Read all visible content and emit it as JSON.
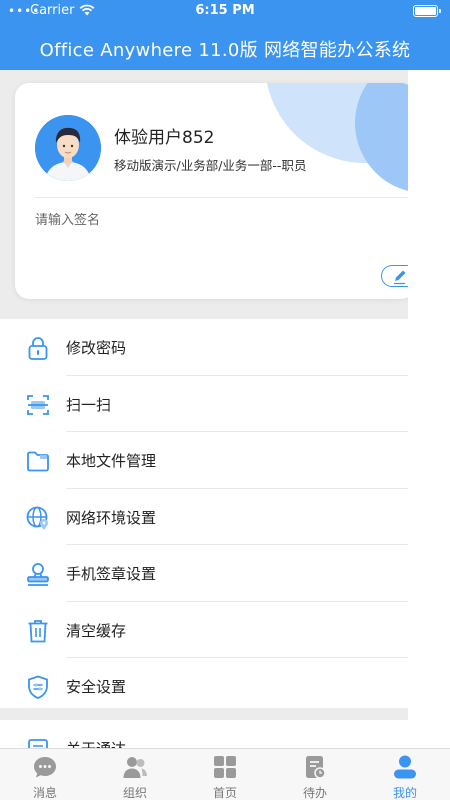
{
  "status_bar": {
    "carrier": "Carrier",
    "time": "6:15 PM"
  },
  "header": {
    "title": "Office Anywhere 11.0版 网络智能办公系统"
  },
  "profile": {
    "name": "体验用户852",
    "department": "移动版演示/业务部/业务一部--职员",
    "signature_placeholder": "请输入签名"
  },
  "menu": [
    {
      "label": "修改密码",
      "icon": "lock-icon"
    },
    {
      "label": "扫一扫",
      "icon": "scan-icon"
    },
    {
      "label": "本地文件管理",
      "icon": "folder-icon"
    },
    {
      "label": "网络环境设置",
      "icon": "globe-icon"
    },
    {
      "label": "手机签章设置",
      "icon": "stamp-icon"
    },
    {
      "label": "清空缓存",
      "icon": "trash-icon"
    },
    {
      "label": "安全设置",
      "icon": "shield-icon"
    }
  ],
  "menu2": [
    {
      "label": "关于通达",
      "icon": "info-icon"
    }
  ],
  "tabs": [
    {
      "label": "消息",
      "icon": "message-icon",
      "active": false
    },
    {
      "label": "组织",
      "icon": "contacts-icon",
      "active": false
    },
    {
      "label": "首页",
      "icon": "home-grid-icon",
      "active": false
    },
    {
      "label": "待办",
      "icon": "todo-icon",
      "active": false
    },
    {
      "label": "我的",
      "icon": "profile-icon",
      "active": true
    }
  ],
  "colors": {
    "primary": "#3a94f0",
    "background": "#ececec",
    "tab_inactive": "#777777"
  }
}
